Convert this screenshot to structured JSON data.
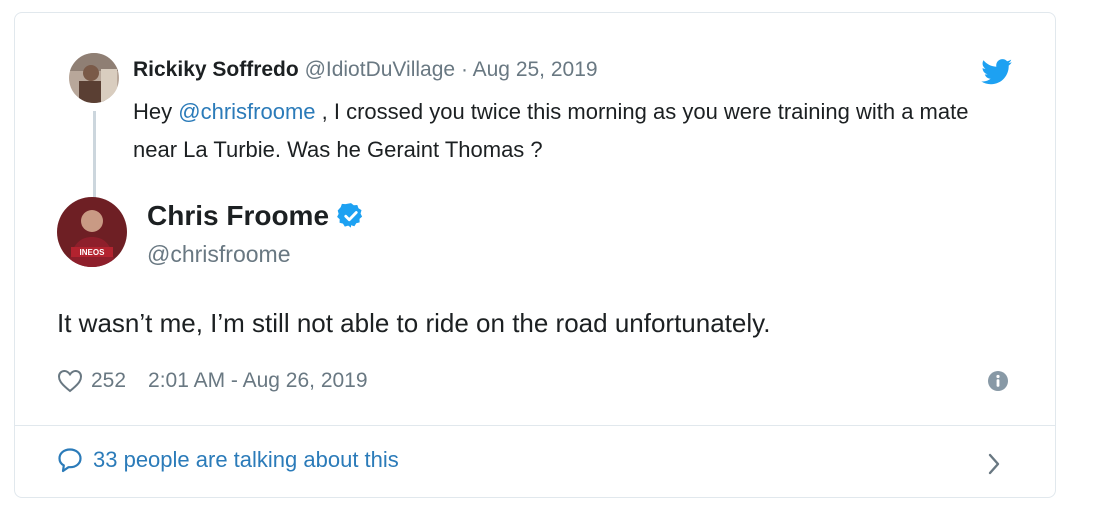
{
  "parent_tweet": {
    "author_name": "Rickiky Soffredo",
    "author_handle": "@IdiotDuVillage",
    "separator": "·",
    "date": "Aug 25, 2019",
    "text_prefix": "Hey ",
    "mention": "@chrisfroome",
    "text_suffix": " , I crossed you twice this morning as you were training with a mate near La Turbie. Was he Geraint Thomas ?"
  },
  "main_tweet": {
    "author_name": "Chris Froome",
    "author_handle": "@chrisfroome",
    "verified": true,
    "avatar_logo_text": "INEOS",
    "text": "It wasn’t me, I’m still not able to ride on the road unfortunately.",
    "like_count": "252",
    "timestamp": "2:01 AM - Aug 26, 2019"
  },
  "footer": {
    "conversation_label": "33 people are talking about this"
  },
  "icons": {
    "brand": "twitter-bird-icon",
    "verified": "verified-badge-icon",
    "like": "heart-icon",
    "info": "info-icon",
    "conversation": "speech-bubble-icon",
    "open": "chevron-right-icon"
  },
  "colors": {
    "link": "#2b7bb9",
    "twitter_blue": "#1da1f2",
    "muted": "#697882",
    "text": "#1c2022",
    "border": "#e1e8ed"
  }
}
